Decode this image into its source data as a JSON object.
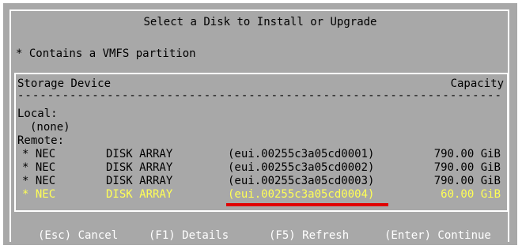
{
  "dialog": {
    "title": "Select a Disk to Install or Upgrade",
    "note": "* Contains a VMFS partition"
  },
  "table": {
    "header_device": "Storage Device",
    "header_capacity": "Capacity",
    "separator": "--------------------------------------------------------------------------------",
    "local_label": "Local:",
    "local_none": "(none)",
    "remote_label": "Remote:",
    "rows": [
      {
        "mark": "* NEC",
        "desc": "DISK ARRAY",
        "id": "(eui.00255c3a05cd0001)",
        "capacity": "790.00 GiB"
      },
      {
        "mark": "* NEC",
        "desc": "DISK ARRAY",
        "id": "(eui.00255c3a05cd0002)",
        "capacity": "790.00 GiB"
      },
      {
        "mark": "* NEC",
        "desc": "DISK ARRAY",
        "id": "(eui.00255c3a05cd0003)",
        "capacity": "790.00 GiB"
      },
      {
        "mark": "* NEC",
        "desc": "DISK ARRAY",
        "id": "(eui.00255c3a05cd0004)",
        "capacity": "60.00 GiB"
      }
    ],
    "selected_index": 3
  },
  "footer": {
    "cancel": "(Esc) Cancel",
    "details": "(F1) Details",
    "refresh": "(F5) Refresh",
    "continue": "(Enter) Continue"
  },
  "colors": {
    "background": "#a8a8a8",
    "selected_text": "#ffff55",
    "annotation_underline": "#e00000",
    "footer_text": "#ffffff"
  }
}
